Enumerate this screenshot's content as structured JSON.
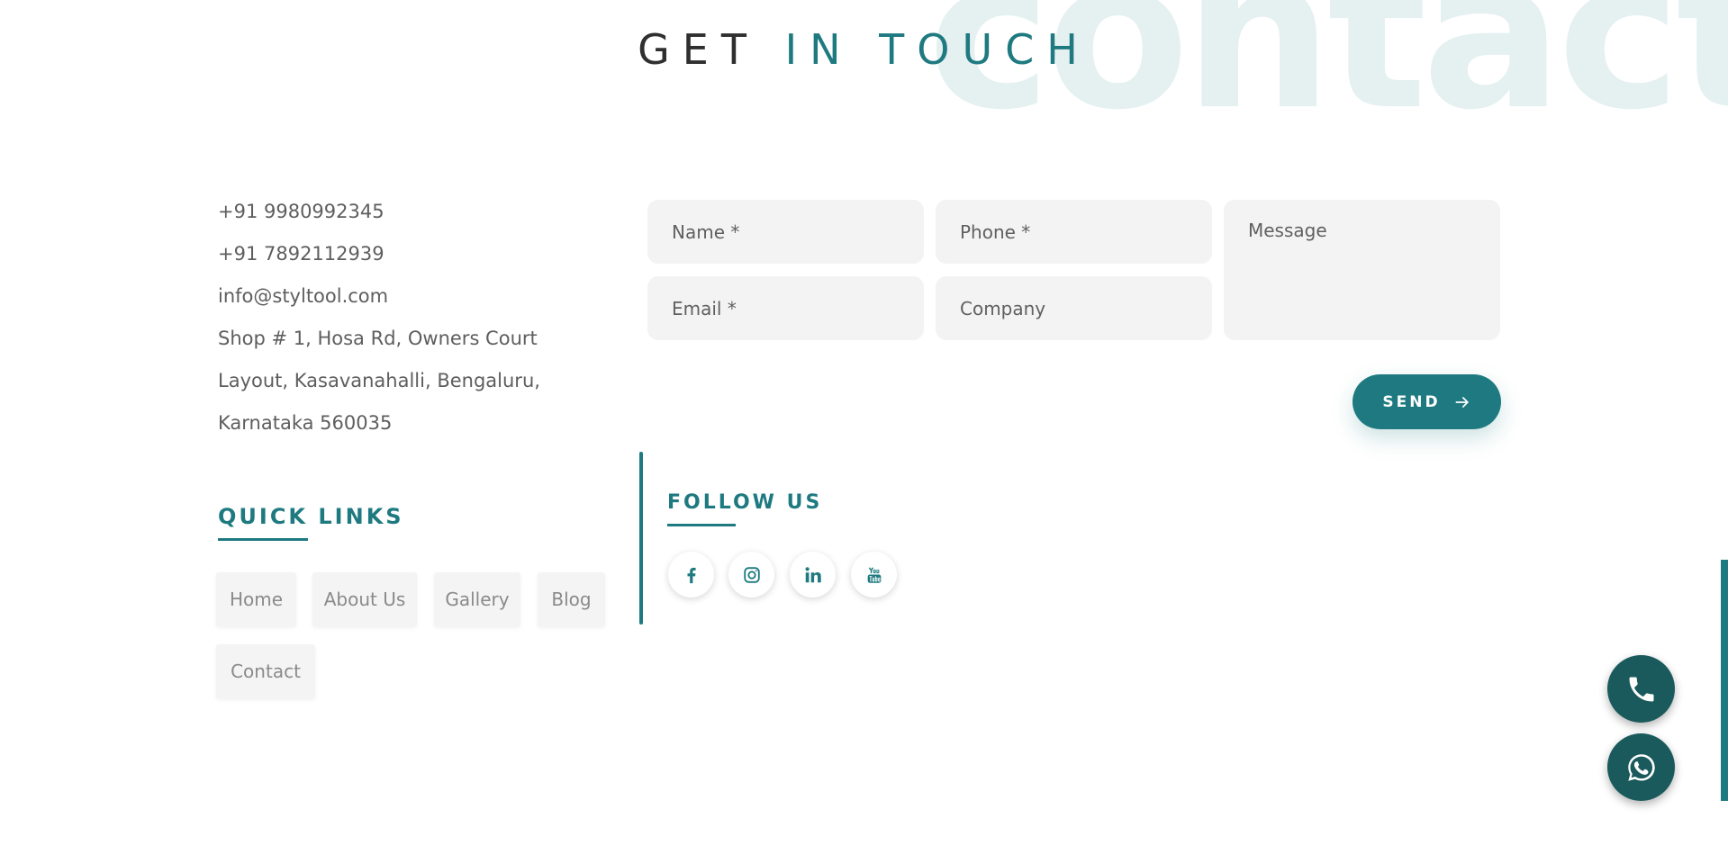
{
  "watermark": "contacts",
  "heading": {
    "part1": "GET ",
    "part2": "IN TOUCH"
  },
  "contact_info": {
    "phone1": "+91 9980992345",
    "phone2": "+91 7892112939",
    "email": "info@styltool.com",
    "address_line1": "Shop # 1, Hosa Rd, Owners Court",
    "address_line2": "Layout, Kasavanahalli, Bengaluru,",
    "address_line3": "Karnataka 560035"
  },
  "form": {
    "name_placeholder": "Name *",
    "phone_placeholder": "Phone *",
    "email_placeholder": "Email *",
    "company_placeholder": "Company",
    "message_placeholder": "Message",
    "send_label": "SEND"
  },
  "quick_links": {
    "title": "QUICK LINKS",
    "items": [
      {
        "label": "Home"
      },
      {
        "label": "About Us"
      },
      {
        "label": "Gallery"
      },
      {
        "label": "Blog"
      },
      {
        "label": "Contact"
      }
    ]
  },
  "follow_us": {
    "title": "FOLLOW US",
    "icons": [
      "facebook-icon",
      "instagram-icon",
      "linkedin-icon",
      "youtube-icon"
    ]
  },
  "floating": {
    "icons": [
      "phone-icon",
      "whatsapp-icon"
    ]
  },
  "colors": {
    "accent": "#1e7a80",
    "dark_accent": "#1a5a5c",
    "text": "#5e5e5e",
    "field_bg": "#f3f3f3",
    "watermark": "#e5f0f0"
  }
}
